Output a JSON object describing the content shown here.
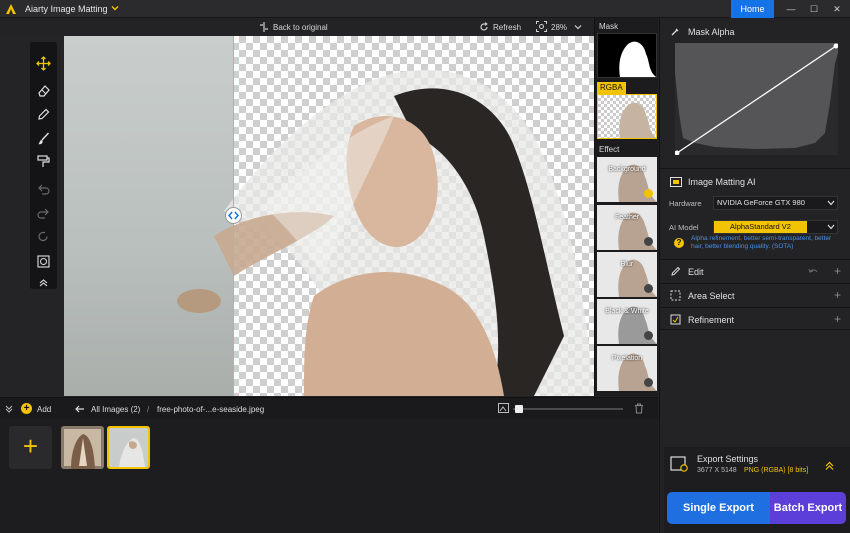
{
  "app": {
    "title": "Aiarty Image Matting",
    "home": "Home",
    "min": "—",
    "max": "☐",
    "close": "✕"
  },
  "toolbar": {
    "back": "Back to original",
    "refresh": "Refresh",
    "zoom": "28%"
  },
  "thumbs": {
    "mask": "Mask",
    "rgba": "RGBA",
    "effect": "Effect",
    "effects": [
      "Background",
      "Feather",
      "Blur",
      "Black & White",
      "Pixelation"
    ]
  },
  "panel": {
    "mask_alpha": "Mask Alpha",
    "matting_ai": "Image Matting AI",
    "hardware_label": "Hardware",
    "hardware_value": "NVIDIA GeForce GTX 980",
    "model_label": "AI Model",
    "model_value": "AlphaStandard  V2",
    "model_desc": "Alpha refinement, better semi-transparent, better hair, better blending quality. (SOTA)",
    "edit": "Edit",
    "area_select": "Area Select",
    "refinement": "Refinement"
  },
  "bottom": {
    "add": "Add",
    "all_images": "All Images (2)",
    "filename": "free-photo-of-...e-seaside.jpeg"
  },
  "export": {
    "settings": "Export Settings",
    "size": "3677 X 5148",
    "format": "PNG (RGBA) [8 bits]",
    "single": "Single Export",
    "batch": "Batch Export"
  },
  "colors": {
    "accent": "#f2c300",
    "home": "#1473e6",
    "single": "#1f6fe0",
    "batch": "#5b3fd8"
  }
}
